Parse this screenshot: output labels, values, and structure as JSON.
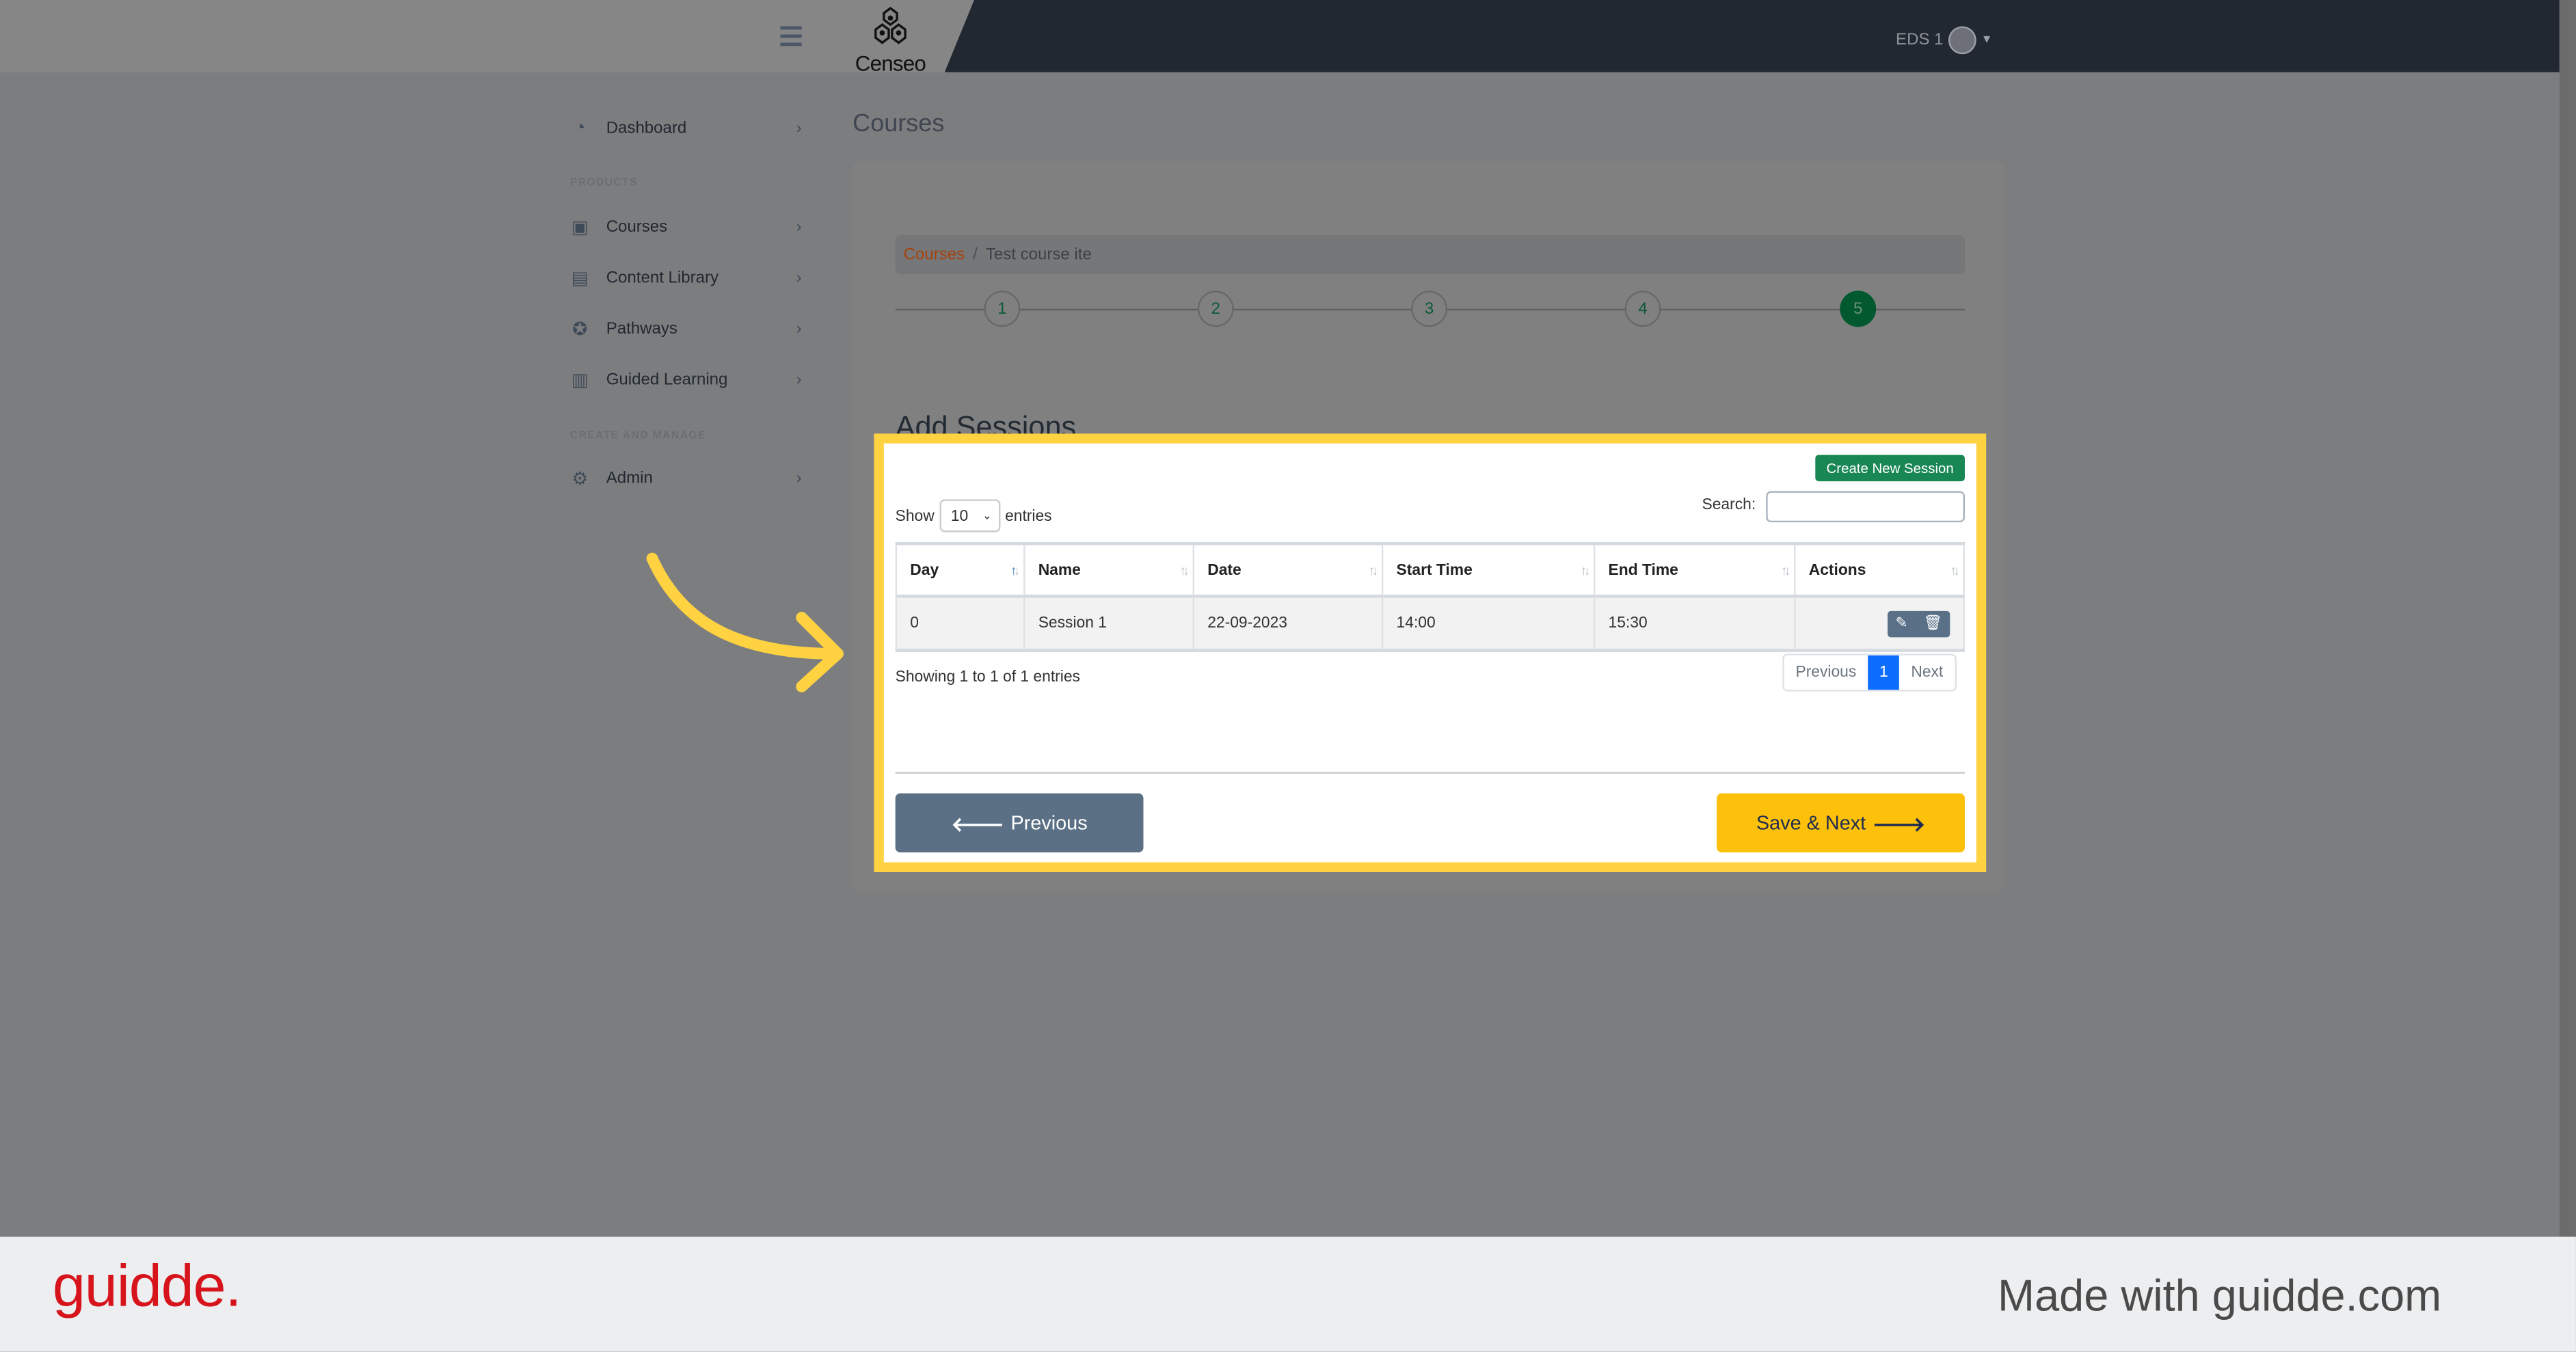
{
  "header": {
    "brand": "Censeo",
    "user": "EDS 1"
  },
  "sidebar": {
    "items": [
      {
        "label": "Dashboard",
        "icon": "dashboard-icon"
      },
      {
        "label": "Courses",
        "icon": "courses-icon"
      },
      {
        "label": "Content Library",
        "icon": "book-icon"
      },
      {
        "label": "Pathways",
        "icon": "award-icon"
      },
      {
        "label": "Guided Learning",
        "icon": "clipboard-list-icon"
      },
      {
        "label": "Admin",
        "icon": "gear-icon"
      }
    ],
    "sections": {
      "products": "PRODUCTS",
      "create": "CREATE AND MANAGE"
    }
  },
  "main": {
    "title": "Courses",
    "breadcrumb": {
      "root": "Courses",
      "sep": "/",
      "current": "Test course ite"
    },
    "steps": [
      "1",
      "2",
      "3",
      "4",
      "5"
    ],
    "active_step": 5,
    "section_title": "Add Sessions",
    "create_button": "Create New Session",
    "show_label": "Show",
    "show_value": "10",
    "entries_label": "entries",
    "search_label": "Search:",
    "search_value": "",
    "table": {
      "headers": [
        "Day",
        "Name",
        "Date",
        "Start Time",
        "End Time",
        "Actions"
      ],
      "rows": [
        [
          "0",
          "Session 1",
          "22-09-2023",
          "14:00",
          "15:30"
        ]
      ]
    },
    "showing": "Showing 1 to 1 of 1 entries",
    "pagination": {
      "prev": "Previous",
      "current": "1",
      "next": "Next"
    },
    "prev_button": "Previous",
    "next_button": "Save & Next"
  },
  "footer": {
    "logo": "guidde.",
    "tagline": "Made with guidde.com"
  },
  "colors": {
    "highlight": "#ffd242",
    "create": "#198754",
    "next": "#fdc10c",
    "prev": "#5b7085",
    "active_page": "#0d6efd",
    "step_active": "#03592f"
  }
}
